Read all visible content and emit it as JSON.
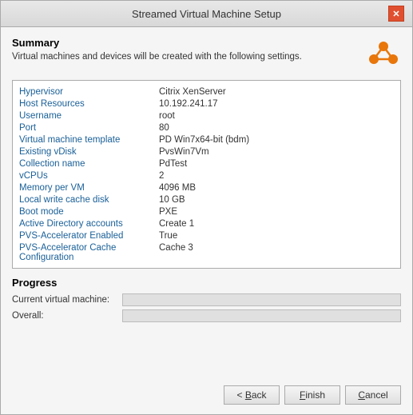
{
  "dialog": {
    "title": "Streamed Virtual Machine Setup",
    "close_label": "✕"
  },
  "summary": {
    "title": "Summary",
    "description": "Virtual machines and devices will be created with the following settings."
  },
  "info_rows": [
    {
      "label": "Hypervisor",
      "value": "Citrix XenServer"
    },
    {
      "label": "Host Resources",
      "value": "10.192.241.17"
    },
    {
      "label": "Username",
      "value": "root"
    },
    {
      "label": "Port",
      "value": "80"
    },
    {
      "label": "Virtual machine template",
      "value": "PD Win7x64-bit (bdm)"
    },
    {
      "label": "Existing vDisk",
      "value": "PvsWin7Vm"
    },
    {
      "label": "Collection name",
      "value": "PdTest"
    },
    {
      "label": "vCPUs",
      "value": "2"
    },
    {
      "label": "Memory per VM",
      "value": "4096 MB"
    },
    {
      "label": "Local write cache disk",
      "value": "10 GB"
    },
    {
      "label": "Boot mode",
      "value": "PXE"
    },
    {
      "label": "Active Directory accounts",
      "value": "Create 1"
    },
    {
      "label": "PVS-Accelerator Enabled",
      "value": "True"
    },
    {
      "label": "PVS-Accelerator Cache Configuration",
      "value": "Cache 3"
    }
  ],
  "progress": {
    "title": "Progress",
    "current_label": "Current virtual machine:",
    "overall_label": "Overall:"
  },
  "buttons": {
    "back": "< Back",
    "finish": "Finish",
    "cancel": "Cancel"
  }
}
